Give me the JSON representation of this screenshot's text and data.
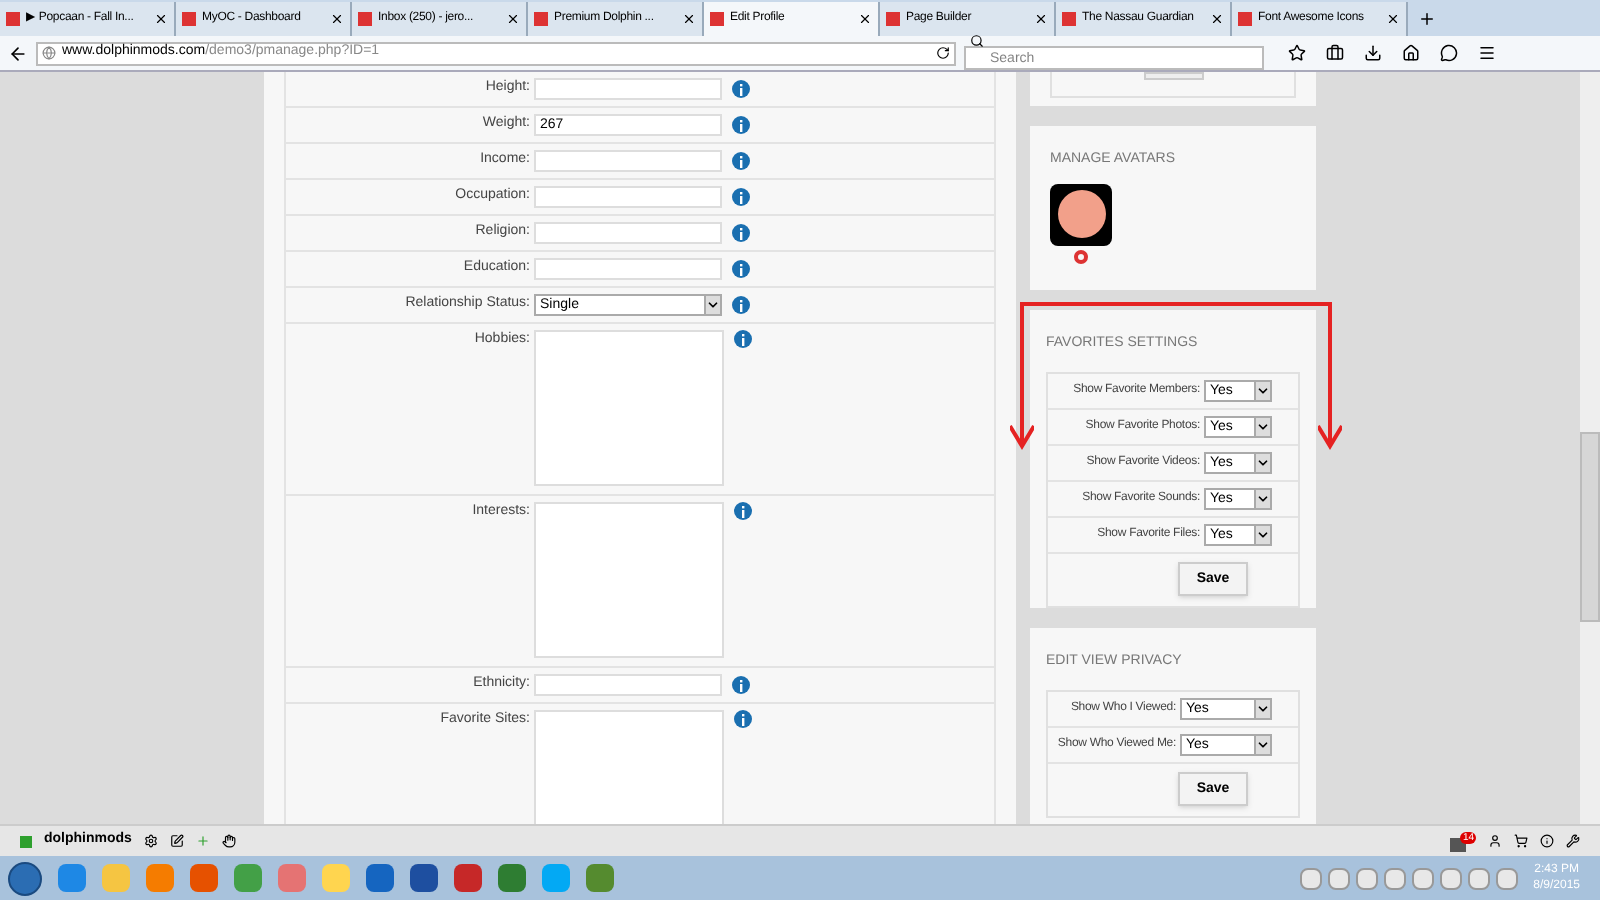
{
  "tabs": [
    {
      "title": "▶ Popcaan - Fall In...",
      "selected": false
    },
    {
      "title": "MyOC - Dashboard",
      "selected": false
    },
    {
      "title": "Inbox (250) - jero...",
      "selected": false
    },
    {
      "title": "Premium Dolphin ...",
      "selected": false
    },
    {
      "title": "Edit Profile",
      "selected": true
    },
    {
      "title": "Page Builder",
      "selected": false
    },
    {
      "title": "The Nassau Guardian",
      "selected": false
    },
    {
      "title": "Font Awesome Icons",
      "selected": false
    }
  ],
  "address_bar": {
    "url_domain": "www.dolphinmods.com",
    "url_path": "/demo3/pmanage.php?ID=1"
  },
  "search": {
    "placeholder": "Search"
  },
  "profile_form": {
    "fields": [
      {
        "label": "Height:",
        "kind": "input"
      },
      {
        "label": "Weight:",
        "kind": "input",
        "value": "267"
      },
      {
        "label": "Income:",
        "kind": "input"
      },
      {
        "label": "Occupation:",
        "kind": "input"
      },
      {
        "label": "Religion:",
        "kind": "input"
      },
      {
        "label": "Education:",
        "kind": "input"
      },
      {
        "label": "Relationship Status:",
        "kind": "select",
        "value": "Single"
      },
      {
        "label": "Hobbies:",
        "kind": "textarea"
      },
      {
        "label": "Interests:",
        "kind": "textarea"
      },
      {
        "label": "Ethnicity:",
        "kind": "input"
      },
      {
        "label": "Favorite Sites:",
        "kind": "textarea"
      }
    ]
  },
  "manage_avatars": {
    "title": "MANAGE AVATARS"
  },
  "favorites_settings": {
    "title": "FAVORITES SETTINGS",
    "rows": [
      {
        "label": "Show Favorite Members:",
        "value": "Yes"
      },
      {
        "label": "Show Favorite Photos:",
        "value": "Yes"
      },
      {
        "label": "Show Favorite Videos:",
        "value": "Yes"
      },
      {
        "label": "Show Favorite Sounds:",
        "value": "Yes"
      },
      {
        "label": "Show Favorite Files:",
        "value": "Yes"
      }
    ],
    "button": "Save"
  },
  "edit_view_privacy": {
    "title": "EDIT VIEW PRIVACY",
    "rows": [
      {
        "label": "Show Who I Viewed:",
        "value": "Yes"
      },
      {
        "label": "Show Who Viewed Me:",
        "value": "Yes"
      }
    ],
    "button": "Save"
  },
  "site_toolbar": {
    "site_name": "dolphinmods",
    "notification_count": "14"
  },
  "taskbar": {
    "time": "2:43 PM",
    "date": "8/9/2015"
  }
}
